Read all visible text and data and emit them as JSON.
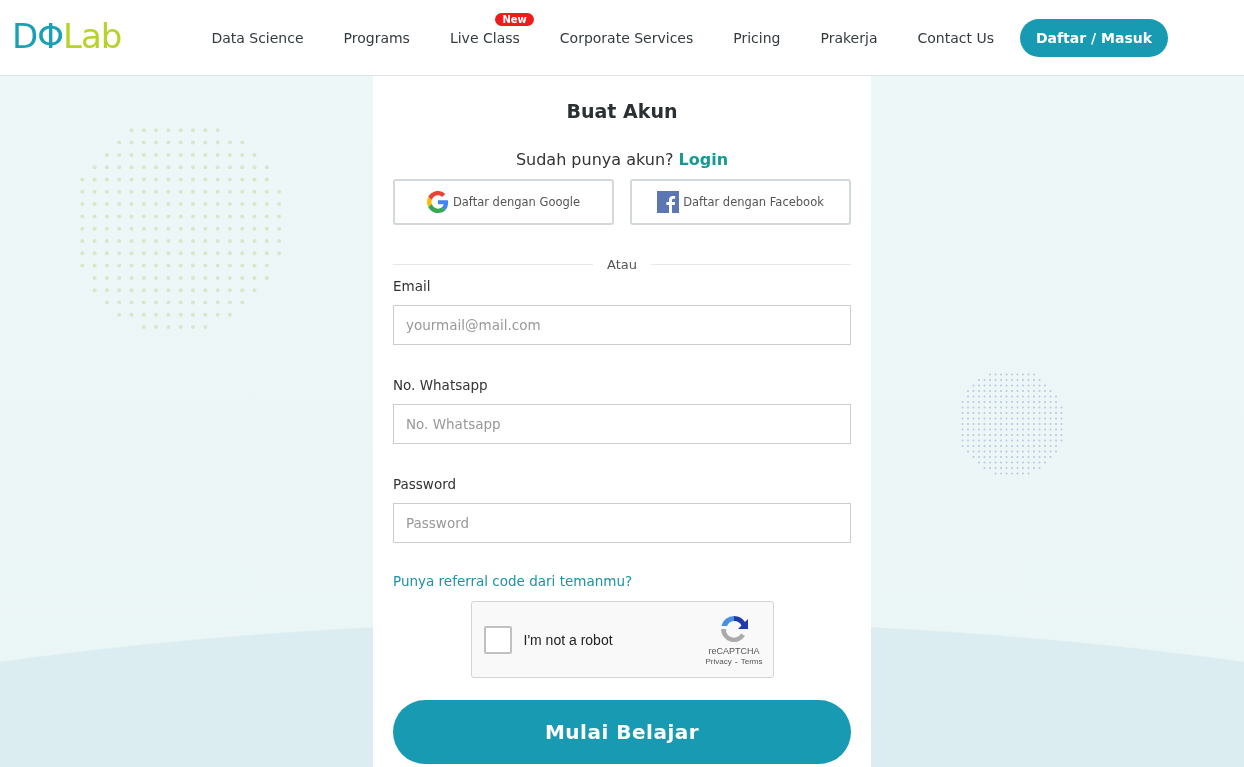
{
  "header": {
    "logo": {
      "first": "DΦ",
      "second": "Lab"
    },
    "nav": [
      {
        "label": "Data Science"
      },
      {
        "label": "Programs"
      },
      {
        "label": "Live Class",
        "badge": "New"
      },
      {
        "label": "Corporate Services"
      },
      {
        "label": "Pricing"
      },
      {
        "label": "Prakerja"
      },
      {
        "label": "Contact Us"
      }
    ],
    "cta": "Daftar / Masuk"
  },
  "form": {
    "title": "Buat Akun",
    "login_prompt": "Sudah punya akun?",
    "login_link": "Login",
    "social": [
      {
        "kind": "google",
        "label": "Daftar dengan Google"
      },
      {
        "kind": "facebook",
        "label": "Daftar dengan Facebook"
      }
    ],
    "divider": "Atau",
    "fields": [
      {
        "label": "Email",
        "placeholder": "yourmail@mail.com"
      },
      {
        "label": "No. Whatsapp",
        "placeholder": "No. Whatsapp"
      },
      {
        "label": "Password",
        "placeholder": "Password"
      }
    ],
    "referral": "Punya referral code dari temanmu?",
    "captcha": {
      "label": "I'm not a robot",
      "checked": false,
      "brand": "reCAPTCHA",
      "privacy": "Privacy",
      "separator": "-",
      "terms": "Terms"
    },
    "submit": "Mulai Belajar"
  }
}
